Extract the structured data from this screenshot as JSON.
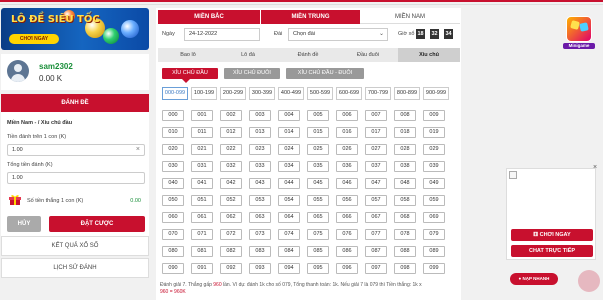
{
  "banner": {
    "title": "LÔ ĐỀ SIÊU TỐC",
    "button": "CHƠI NGAY"
  },
  "user": {
    "name": "sam2302",
    "balance": "0.00 K"
  },
  "left": {
    "tab": "ĐÁNH ĐỀ",
    "form_title": "Miền Nam - / Xiu chủ đầu",
    "label_per": "Tiền đánh trên 1 con (K)",
    "value_per": "1.00",
    "label_total": "Tổng tiền đánh (K)",
    "value_total": "1.00",
    "win_label": "Số tiền thắng 1 con (K)",
    "win_value": "0.00",
    "cancel": "HỦY",
    "bet": "ĐẶT CƯỢC",
    "results": "KẾT QUẢ XỔ SỐ",
    "history": "LỊCH SỬ ĐÁNH"
  },
  "regions": [
    "MIỀN BẮC",
    "MIỀN TRUNG",
    "MIỀN NAM"
  ],
  "filters": {
    "date_label": "Ngày",
    "date_value": "24-12-2022",
    "station_label": "Đài",
    "station_value": "Chọn đài",
    "quick_label": "Giờ xổ",
    "quick": [
      "18",
      "32",
      "34"
    ]
  },
  "bet_types": [
    "Bao lô",
    "Lô đá",
    "Đánh đề",
    "Đầu đuôi",
    "Xiu chủ"
  ],
  "sub_types": [
    "XỈU CHỦ ĐẦU",
    "XỈU CHỦ ĐUÔI",
    "XỈU CHỦ ĐẦU - ĐUÔI"
  ],
  "ranges": [
    "000-099",
    "100-199",
    "200-299",
    "300-399",
    "400-499",
    "500-599",
    "600-699",
    "700-799",
    "800-899",
    "900-999"
  ],
  "numbers": [
    "000",
    "001",
    "002",
    "003",
    "004",
    "005",
    "006",
    "007",
    "008",
    "009",
    "010",
    "011",
    "012",
    "013",
    "014",
    "015",
    "016",
    "017",
    "018",
    "019",
    "020",
    "021",
    "022",
    "023",
    "024",
    "025",
    "026",
    "027",
    "028",
    "029",
    "030",
    "031",
    "032",
    "033",
    "034",
    "035",
    "036",
    "037",
    "038",
    "039",
    "040",
    "041",
    "042",
    "043",
    "044",
    "045",
    "046",
    "047",
    "048",
    "049",
    "050",
    "051",
    "052",
    "053",
    "054",
    "055",
    "056",
    "057",
    "058",
    "059",
    "060",
    "061",
    "062",
    "063",
    "064",
    "065",
    "066",
    "067",
    "068",
    "069",
    "070",
    "071",
    "072",
    "073",
    "074",
    "075",
    "076",
    "077",
    "078",
    "079",
    "080",
    "081",
    "082",
    "083",
    "084",
    "085",
    "086",
    "087",
    "088",
    "089",
    "090",
    "091",
    "092",
    "093",
    "094",
    "095",
    "096",
    "097",
    "098",
    "099"
  ],
  "note": {
    "line1a": "Đánh giải 7. Thắng gấp ",
    "rate": "960",
    "line1b": " lần. Ví dụ: đánh 1k cho số 079, Tổng thanh toán: 1k. Nếu giải 7 là 079 thì Tiền thắng: 1k x",
    "line2": "960 = 960K"
  },
  "right": {
    "minigame": "Minigame",
    "play_now": "CHƠI NGAY",
    "live_chat": "CHAT TRỰC TIẾP",
    "topup": "NẠP NHANH",
    "close": "×"
  }
}
